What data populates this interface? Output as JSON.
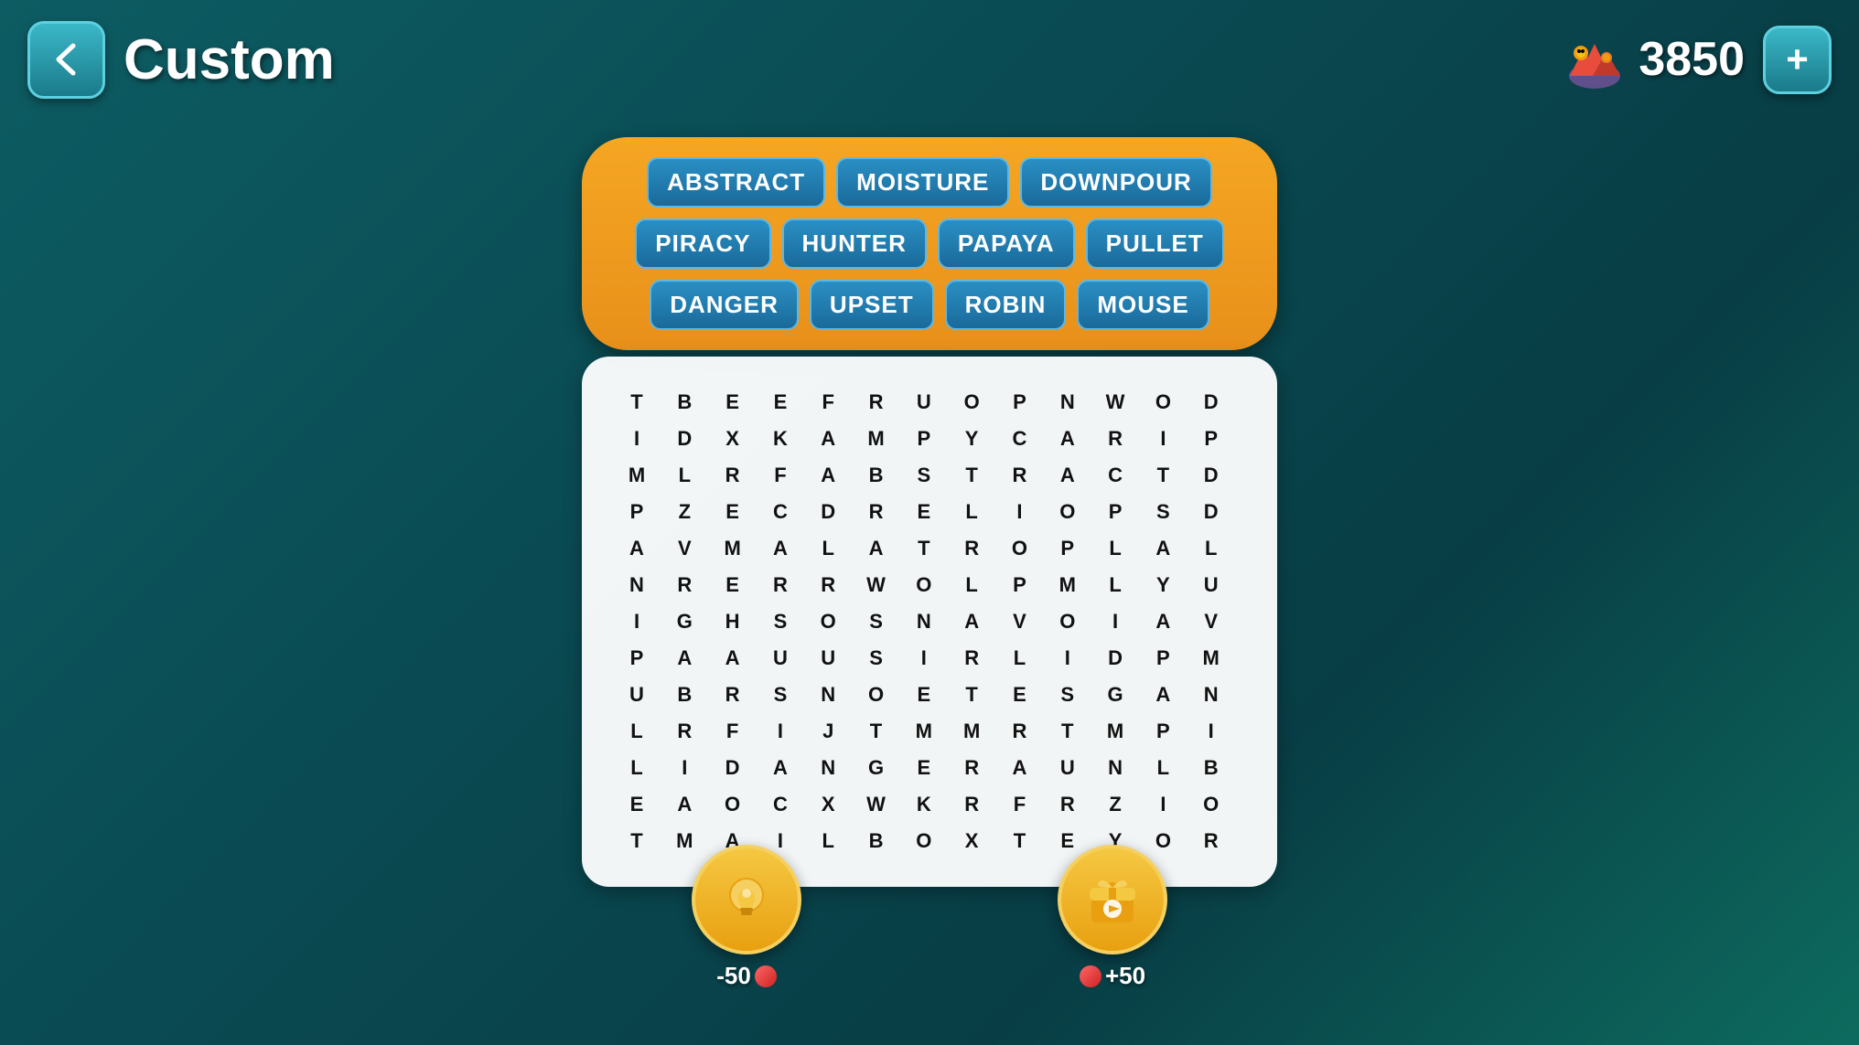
{
  "header": {
    "title": "Custom",
    "score": "3850",
    "back_label": "back",
    "add_label": "+"
  },
  "word_tags": [
    "ABSTRACT",
    "MOISTURE",
    "DOWNPOUR",
    "PIRACY",
    "HUNTER",
    "PAPAYA",
    "PULLET",
    "DANGER",
    "UPSET",
    "ROBIN",
    "MOUSE"
  ],
  "grid": {
    "rows": [
      [
        "T",
        "B",
        "E",
        "E",
        "F",
        "R",
        "U",
        "O",
        "P",
        "N",
        "W",
        "O",
        "D",
        "",
        "",
        "",
        ""
      ],
      [
        "I",
        "D",
        "X",
        "K",
        "A",
        "M",
        "P",
        "Y",
        "C",
        "A",
        "R",
        "I",
        "P",
        "",
        "",
        "",
        ""
      ],
      [
        "M",
        "L",
        "R",
        "F",
        "A",
        "B",
        "S",
        "T",
        "R",
        "A",
        "C",
        "T",
        "D",
        "",
        "",
        "",
        ""
      ],
      [
        "P",
        "Z",
        "E",
        "C",
        "D",
        "R",
        "E",
        "L",
        "I",
        "O",
        "P",
        "S",
        "D",
        "",
        "",
        "",
        ""
      ],
      [
        "A",
        "V",
        "M",
        "A",
        "L",
        "A",
        "T",
        "R",
        "O",
        "P",
        "L",
        "A",
        "L",
        "",
        "",
        "",
        ""
      ],
      [
        "N",
        "R",
        "E",
        "R",
        "R",
        "W",
        "O",
        "L",
        "P",
        "M",
        "L",
        "Y",
        "U",
        "",
        "",
        "",
        ""
      ],
      [
        "I",
        "G",
        "H",
        "S",
        "O",
        "S",
        "N",
        "A",
        "V",
        "O",
        "I",
        "A",
        "V",
        "",
        "",
        "",
        ""
      ],
      [
        "P",
        "A",
        "A",
        "U",
        "U",
        "S",
        "I",
        "R",
        "L",
        "I",
        "D",
        "P",
        "M",
        "",
        "",
        "",
        ""
      ],
      [
        "U",
        "B",
        "R",
        "S",
        "N",
        "O",
        "E",
        "T",
        "E",
        "S",
        "G",
        "A",
        "N",
        "",
        "",
        "",
        ""
      ],
      [
        "L",
        "R",
        "F",
        "I",
        "J",
        "T",
        "M",
        "M",
        "R",
        "T",
        "M",
        "P",
        "I",
        "",
        "",
        "",
        ""
      ],
      [
        "L",
        "I",
        "D",
        "A",
        "N",
        "G",
        "E",
        "R",
        "A",
        "U",
        "N",
        "L",
        "B",
        "",
        "",
        "",
        ""
      ],
      [
        "E",
        "A",
        "O",
        "C",
        "X",
        "W",
        "K",
        "R",
        "F",
        "R",
        "Z",
        "I",
        "O",
        "",
        "",
        "",
        ""
      ],
      [
        "T",
        "M",
        "A",
        "I",
        "L",
        "B",
        "O",
        "X",
        "T",
        "E",
        "Y",
        "O",
        "R",
        "",
        "",
        "",
        ""
      ]
    ],
    "cols": 13
  },
  "bottom_buttons": {
    "hint": {
      "label": "-50",
      "icon": "lightbulb"
    },
    "reward": {
      "label": "+50",
      "icon": "gift"
    }
  },
  "colors": {
    "bg_start": "#0d5c63",
    "bg_end": "#0d6b5e",
    "accent_orange": "#f5a623",
    "tag_blue": "#2a8fc4",
    "panel_bg": "#ffffff"
  }
}
